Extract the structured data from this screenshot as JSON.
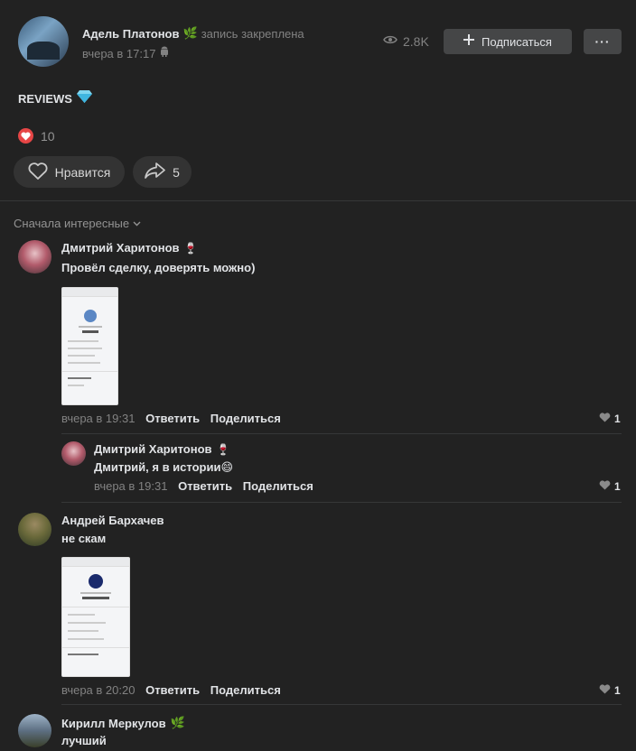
{
  "post": {
    "author": "Адель Платонов",
    "pinned_text": "запись закреплена",
    "time": "вчера в 17:17",
    "views": "2.8K",
    "subscribe_label": "Подписаться",
    "more_label": "···",
    "text": "REVIEWS",
    "reactions_count": "10",
    "like_label": "Нравится",
    "share_count": "5"
  },
  "comments_sort": "Сначала интересные",
  "comments": [
    {
      "author": "Дмитрий Харитонов",
      "text": "Провёл сделку, доверять можно)",
      "time": "вчера в 19:31",
      "reply_label": "Ответить",
      "share_label": "Поделиться",
      "likes": "1"
    },
    {
      "author": "Дмитрий Харитонов",
      "text": "Дмитрий, я в истории😄",
      "time": "вчера в 19:31",
      "reply_label": "Ответить",
      "share_label": "Поделиться",
      "likes": "1"
    },
    {
      "author": "Андрей Бархачев",
      "text": "не скам",
      "time": "вчера в 20:20",
      "reply_label": "Ответить",
      "share_label": "Поделиться",
      "likes": "1"
    },
    {
      "author": "Кирилл Меркулов",
      "text": "лучший"
    }
  ],
  "colors": {
    "background": "#222222",
    "button": "#454647",
    "heart": "#e64646",
    "muted": "#828282"
  }
}
